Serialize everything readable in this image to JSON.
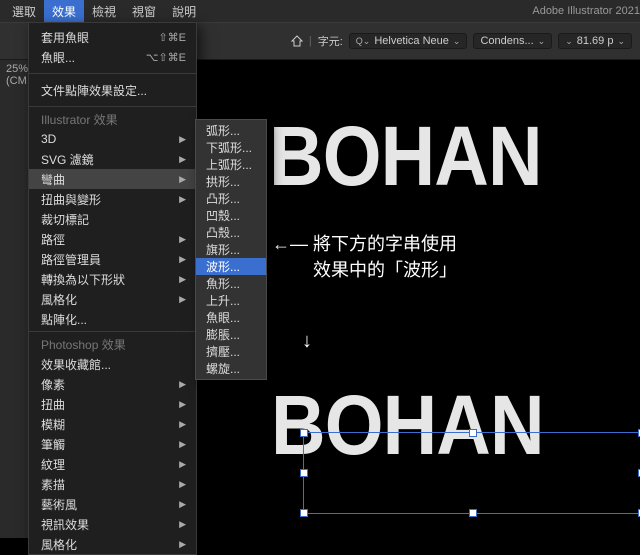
{
  "app_title": "Adobe Illustrator 2021",
  "menubar": {
    "items": [
      "選取",
      "效果",
      "檢視",
      "視窗",
      "說明"
    ],
    "active_index": 1
  },
  "zoom_label": "25% (CM",
  "controlbar": {
    "char_label": "字元:",
    "font_family": "Helvetica Neue",
    "font_style": "Condens...",
    "font_size": "81.69 p"
  },
  "effects_menu": {
    "top": [
      {
        "label": "套用魚眼",
        "shortcut": "⇧⌘E"
      },
      {
        "label": "魚眼...",
        "shortcut": "⌥⇧⌘E"
      }
    ],
    "settings": {
      "label": "文件點陣效果設定..."
    },
    "section1_title": "Illustrator 效果",
    "section1": [
      "3D",
      "SVG 濾鏡",
      "彎曲",
      "扭曲與變形",
      "裁切標記",
      "路徑",
      "路徑管理員",
      "轉換為以下形狀",
      "風格化",
      "點陣化..."
    ],
    "section1_hi_index": 2,
    "section2_title": "Photoshop 效果",
    "section2": [
      "效果收藏館...",
      "像素",
      "扭曲",
      "模糊",
      "筆觸",
      "紋理",
      "素描",
      "藝術風",
      "視訊效果",
      "風格化"
    ]
  },
  "warp_submenu": {
    "items": [
      "弧形...",
      "下弧形...",
      "上弧形...",
      "拱形...",
      "凸形...",
      "凹殼...",
      "凸殼...",
      "旗形...",
      "波形...",
      "魚形...",
      "上升...",
      "魚眼...",
      "膨脹...",
      "擠壓...",
      "螺旋..."
    ],
    "hi_index": 8
  },
  "canvas_text": {
    "top": "BOHAN",
    "bottom": "BOHAN"
  },
  "annotation": {
    "line1": "←— 將下方的字串使用",
    "line2": "　　 效果中的「波形」",
    "down": "↓"
  }
}
